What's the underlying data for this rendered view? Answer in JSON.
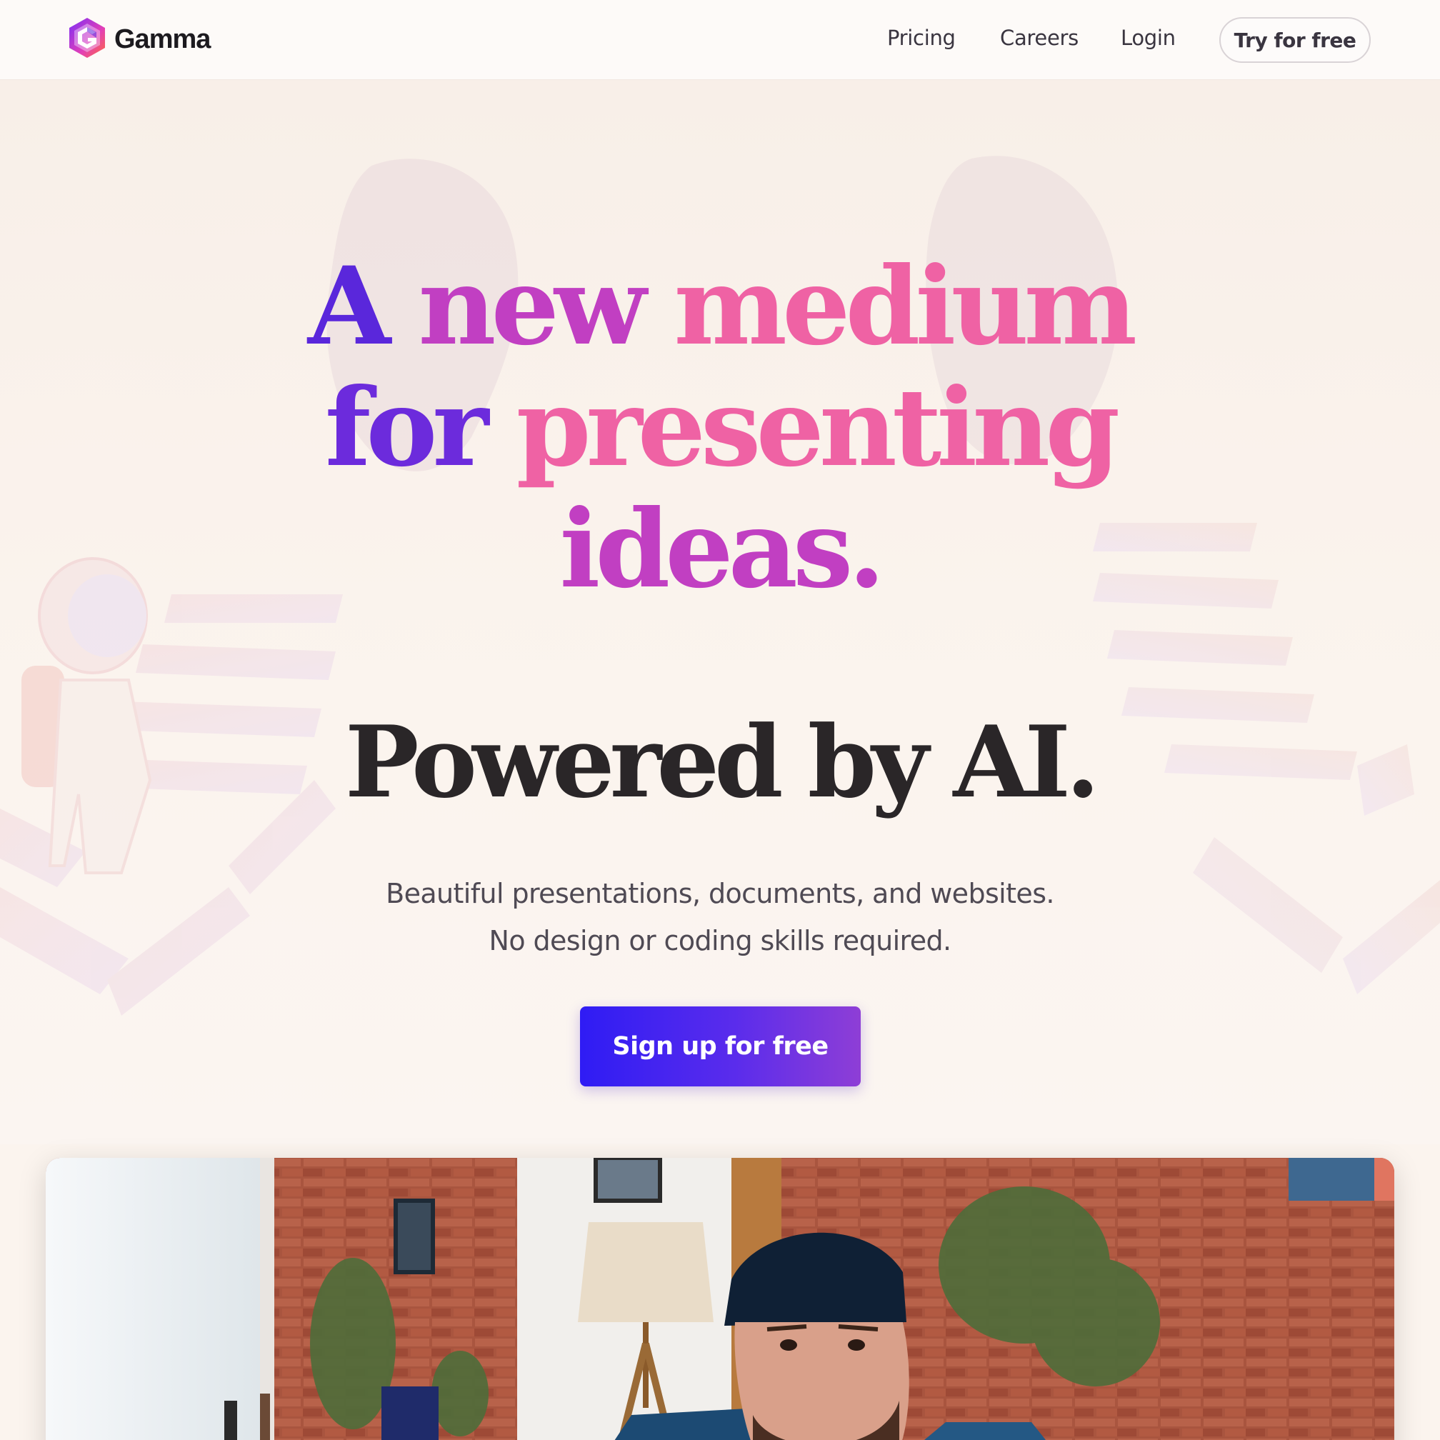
{
  "nav": {
    "brand_name": "Gamma",
    "links": [
      "Pricing",
      "Careers",
      "Login"
    ],
    "cta_label": "Try for free"
  },
  "hero": {
    "headline": {
      "line1_word1": "A",
      "line1_word2": "new",
      "line1_word3": "medium",
      "line2_word1": "for",
      "line2_word2": "presenting",
      "line3_word1": "ideas."
    },
    "powered": "Powered by AI.",
    "subtitle_line1": "Beautiful presentations, documents, and websites.",
    "subtitle_line2": "No design or coding skills required.",
    "cta_label": "Sign up for free"
  },
  "colors": {
    "accent_purple": "#5a27db",
    "accent_pink": "#ef62a4",
    "accent_orange": "#f7975a",
    "cta_gradient_start": "#2f1cf4",
    "cta_gradient_end": "#8e3ed6"
  },
  "icons": {
    "logo": "gamma-logo-icon"
  }
}
